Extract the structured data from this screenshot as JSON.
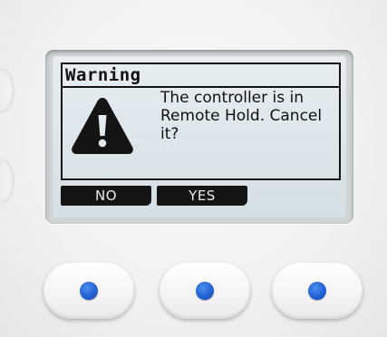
{
  "dialog": {
    "title": "Warning",
    "message": "The controller is in Remote Hold. Cancel it?",
    "icon": "warning-triangle-icon"
  },
  "softkeys": {
    "no_label": "NO",
    "yes_label": "YES"
  },
  "hardware": {
    "button_led_color": "#1f5fd0",
    "screen_color": "#dbe5ea"
  }
}
